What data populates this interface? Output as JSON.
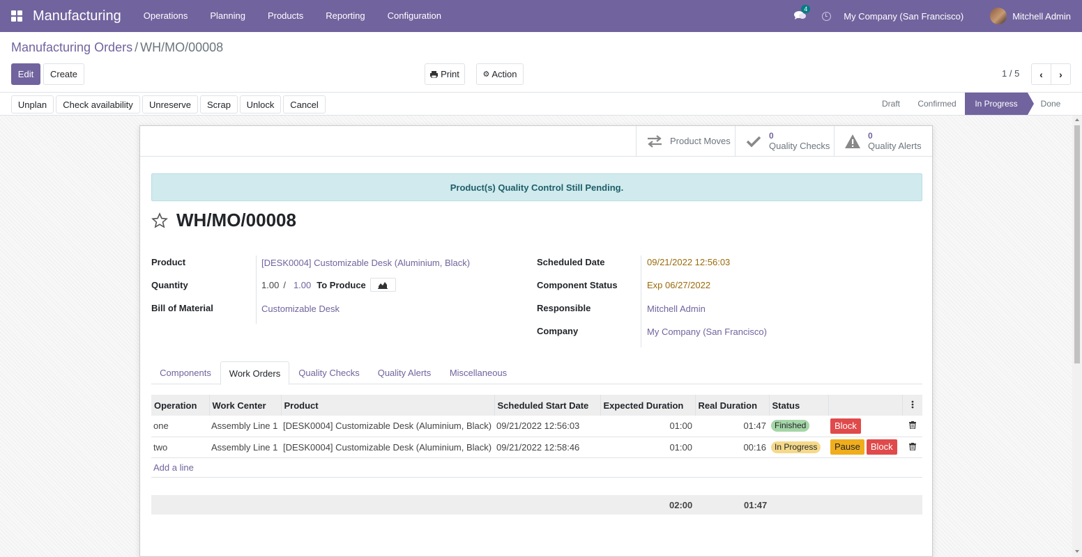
{
  "navbar": {
    "app_name": "Manufacturing",
    "menu": [
      "Operations",
      "Planning",
      "Products",
      "Reporting",
      "Configuration"
    ],
    "notification_count": "4",
    "company": "My Company (San Francisco)",
    "user": "Mitchell Admin"
  },
  "breadcrumb": {
    "parent": "Manufacturing Orders",
    "separator": "/",
    "current": "WH/MO/00008"
  },
  "toolbar": {
    "edit": "Edit",
    "create": "Create",
    "print": "Print",
    "action": "Action",
    "pager": "1 / 5"
  },
  "statusbar": {
    "buttons": [
      "Unplan",
      "Check availability",
      "Unreserve",
      "Scrap",
      "Unlock",
      "Cancel"
    ],
    "stages": [
      "Draft",
      "Confirmed",
      "In Progress",
      "Done"
    ],
    "active_stage": "In Progress"
  },
  "smart_buttons": {
    "product_moves": "Product Moves",
    "quality_checks": {
      "count": "0",
      "label": "Quality Checks"
    },
    "quality_alerts": {
      "count": "0",
      "label": "Quality Alerts"
    }
  },
  "alert": "Product(s) Quality Control Still Pending.",
  "record": {
    "name": "WH/MO/00008",
    "left_fields": {
      "product_label": "Product",
      "product": "[DESK0004] Customizable Desk (Aluminium, Black)",
      "quantity_label": "Quantity",
      "quantity_done": "1.00",
      "quantity_sep": "/",
      "quantity_total": "1.00",
      "to_produce": "To Produce",
      "bom_label": "Bill of Material",
      "bom": "Customizable Desk"
    },
    "right_fields": {
      "scheduled_label": "Scheduled Date",
      "scheduled": "09/21/2022 12:56:03",
      "component_label": "Component Status",
      "component": "Exp 06/27/2022",
      "responsible_label": "Responsible",
      "responsible": "Mitchell Admin",
      "company_label": "Company",
      "company": "My Company (San Francisco)"
    }
  },
  "tabs": [
    "Components",
    "Work Orders",
    "Quality Checks",
    "Quality Alerts",
    "Miscellaneous"
  ],
  "active_tab": "Work Orders",
  "work_orders": {
    "columns": [
      "Operation",
      "Work Center",
      "Product",
      "Scheduled Start Date",
      "Expected Duration",
      "Real Duration",
      "Status"
    ],
    "rows": [
      {
        "operation": "one",
        "work_center": "Assembly Line 1",
        "product": "[DESK0004] Customizable Desk (Aluminium, Black)",
        "start": "09/21/2022 12:56:03",
        "expected": "01:00",
        "real": "01:47",
        "status": "Finished",
        "actions": [
          "Block"
        ]
      },
      {
        "operation": "two",
        "work_center": "Assembly Line 1",
        "product": "[DESK0004] Customizable Desk (Aluminium, Black)",
        "start": "09/21/2022 12:58:46",
        "expected": "01:00",
        "real": "00:16",
        "status": "In Progress",
        "actions": [
          "Pause",
          "Block"
        ]
      }
    ],
    "add_line": "Add a line",
    "total_expected": "02:00",
    "total_real": "01:47"
  },
  "colors": {
    "brand": "#71639e",
    "finished_pill": "#a5d6a7",
    "progress_pill": "#f5d98b",
    "block_btn": "#e04a4a",
    "pause_btn": "#f0ad1c"
  }
}
